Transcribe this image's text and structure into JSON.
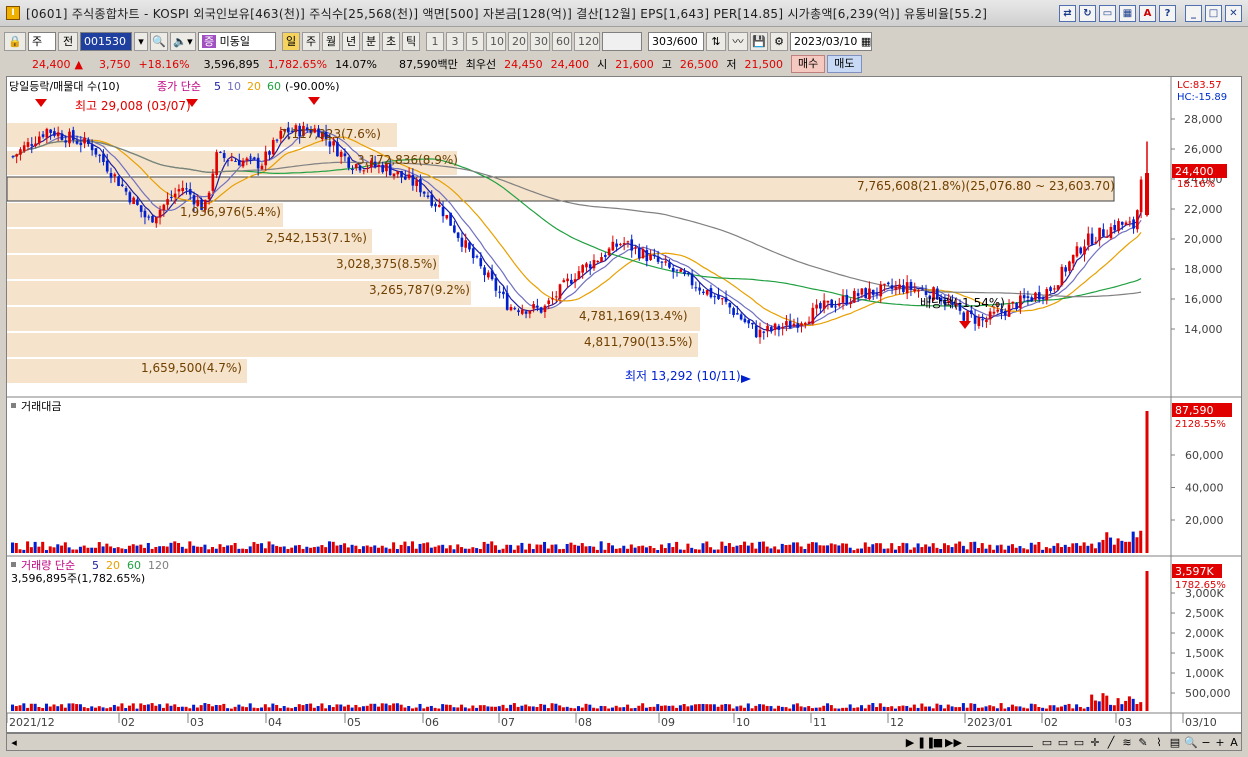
{
  "titlebar": {
    "text": "[0601] 주식종합차트 - KOSPI 외국인보유[463(천)] 주식수[25,568(천)] 액면[500] 자본금[128(억)] 결산[12월] EPS[1,643] PER[14.85] 시가총액[6,239(억)] 유통비율[55.2]",
    "app_icon": "I"
  },
  "toolbar": {
    "period_select": "주",
    "prev_label": "전",
    "code": "001530",
    "stock_name": "미동일",
    "periods": [
      "일",
      "주",
      "월",
      "년",
      "분",
      "초",
      "틱"
    ],
    "intervals": [
      "1",
      "3",
      "5",
      "10",
      "20",
      "30",
      "60",
      "120"
    ],
    "count": "303/600",
    "date": "2023/03/10"
  },
  "quote": {
    "price": "24,400",
    "change": "3,750",
    "change_rate": "+18.16%",
    "volume": "3,596,895",
    "volume_rate": "1,782.65%",
    "turnover": "14.07%",
    "amount": "87,590백만",
    "best_label": "최우선",
    "ask": "24,450",
    "bid": "24,400",
    "open_label": "시",
    "open": "21,600",
    "high_label": "고",
    "high": "26,500",
    "low_label": "저",
    "low": "21,500",
    "buy_label": "매수",
    "sell_label": "매도"
  },
  "price_panel": {
    "legend": "당일등락/매물대 수(10)",
    "ma_label": "종가 단순",
    "ma_values": [
      "5",
      "10",
      "20",
      "60"
    ],
    "ma_extra": "(-90.00%)",
    "lc": "LC:83.57",
    "hc": "HC:-15.89",
    "y_ticks": [
      "28,000",
      "26,000",
      "24,000",
      "22,000",
      "20,000",
      "18,000",
      "16,000",
      "14,000"
    ],
    "current_price": "24,400",
    "current_rate": "18.16%",
    "high_note": "최고 29,008 (03/07)",
    "low_note": "최저 13,292 (10/11)",
    "dividend_note": "배당락(-1.54%)",
    "volume_profile": [
      "7,765,608(21.8%)(25,076.80 ~ 23,603.70)",
      "7,117,323(7.6%)",
      "3,172,836(8.9%)",
      "1,936,976(5.4%)",
      "2,542,153(7.1%)",
      "3,028,375(8.5%)",
      "3,265,787(9.2%)",
      "4,781,169(13.4%)",
      "4,811,790(13.5%)",
      "1,659,500(4.7%)"
    ]
  },
  "amount_panel": {
    "legend": "거래대금",
    "y_ticks": [
      "60,000",
      "40,000",
      "20,000"
    ],
    "current": "87,590",
    "current_rate": "2128.55%"
  },
  "volume_panel": {
    "legend": "거래량 단순",
    "ma_values": [
      "5",
      "20",
      "60",
      "120"
    ],
    "sub_legend": "3,596,895주(1,782.65%)",
    "y_ticks": [
      "3,000K",
      "2,500K",
      "2,000K",
      "1,500K",
      "1,000K",
      "500,000"
    ],
    "current": "3,597K",
    "current_rate": "1782.65%"
  },
  "x_axis": [
    "2021/12",
    "02",
    "03",
    "04",
    "05",
    "06",
    "07",
    "08",
    "09",
    "10",
    "11",
    "12",
    "2023/01",
    "02",
    "03",
    "03/10"
  ],
  "colors": {
    "up": "#e00000",
    "down": "#0020d0",
    "ma5": "#2020a0",
    "ma10": "#7070c0",
    "ma20": "#e8a000",
    "ma60": "#20a040",
    "ma120": "#808080",
    "profile": "#f5e3cc"
  }
}
